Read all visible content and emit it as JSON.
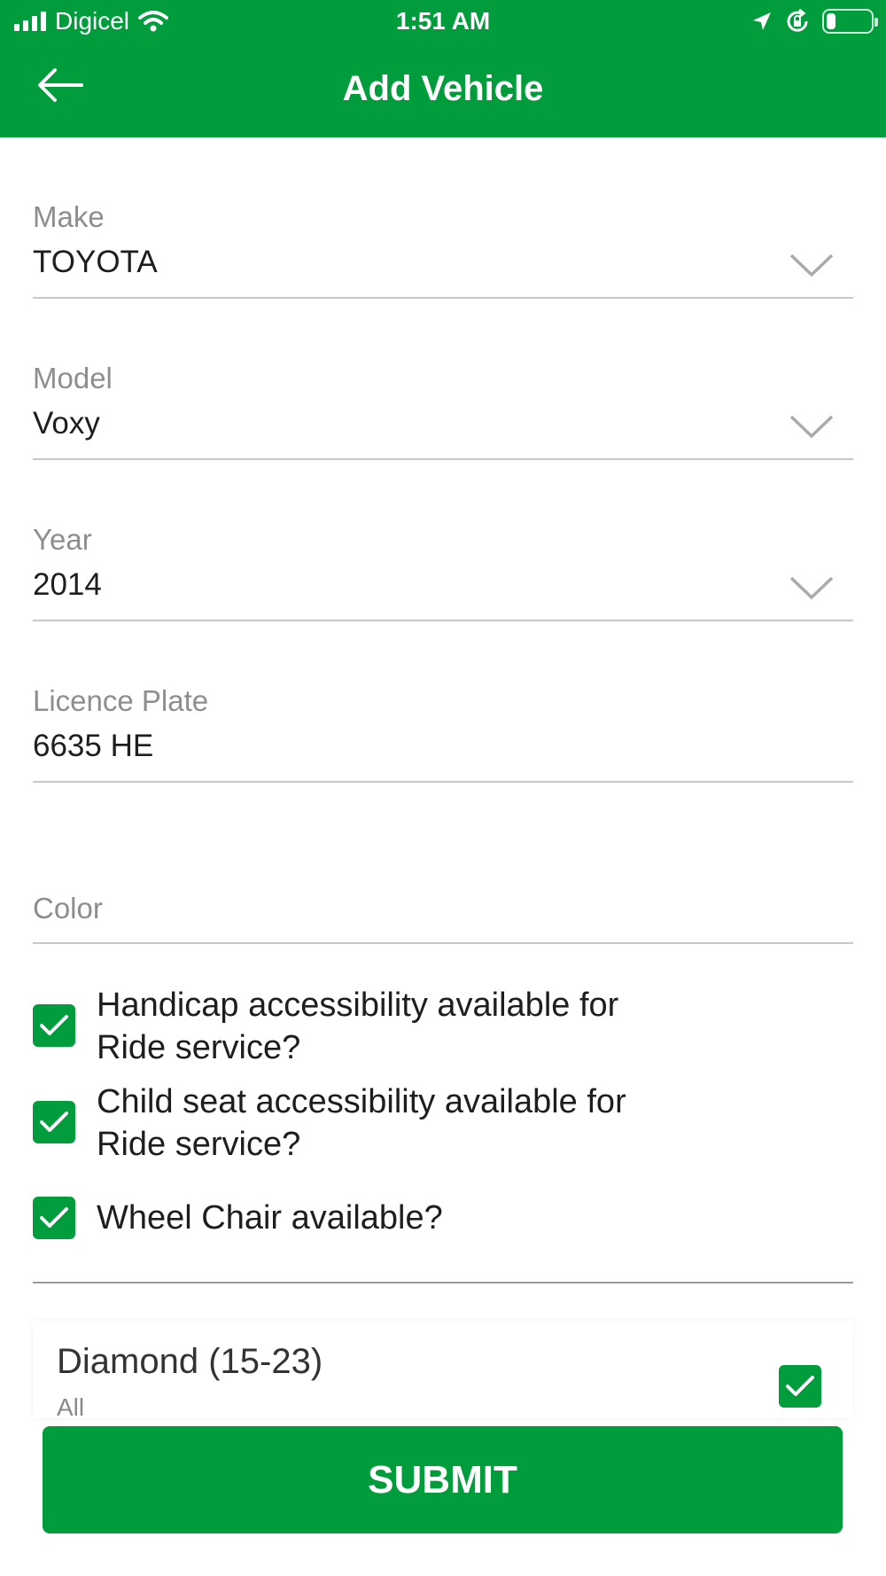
{
  "status_bar": {
    "carrier": "Digicel",
    "time": "1:51 AM",
    "battery_level": 0.2
  },
  "header": {
    "title": "Add Vehicle",
    "back_icon": "arrow-left-icon",
    "background_color": "#019c3c"
  },
  "form": {
    "make": {
      "label": "Make",
      "value": "TOYOTA"
    },
    "model": {
      "label": "Model",
      "value": "Voxy"
    },
    "year": {
      "label": "Year",
      "value": "2014"
    },
    "licence_plate": {
      "label": "Licence Plate",
      "value": "6635 HE"
    },
    "color": {
      "label": "Color",
      "value": ""
    }
  },
  "options": [
    {
      "label": "Handicap accessibility available for\nRide service?",
      "checked": true
    },
    {
      "label": "Child seat accessibility available for\nRide service?",
      "checked": true
    },
    {
      "label": "Wheel Chair available?",
      "checked": true
    }
  ],
  "vehicle_category": {
    "title": "Diamond (15-23)",
    "subtitle": "All",
    "checked": true
  },
  "submit": {
    "label": "SUBMIT"
  }
}
